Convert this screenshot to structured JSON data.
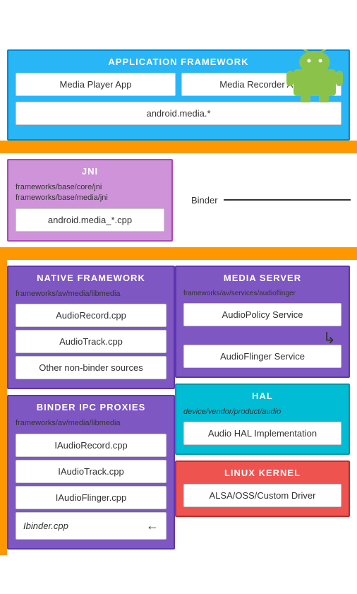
{
  "android": {
    "logo_color": "#8bc34a"
  },
  "app_framework": {
    "title": "APPLICATION FRAMEWORK",
    "media_player": "Media Player App",
    "media_recorder": "Media Recorder App",
    "android_media": "android.media.*"
  },
  "jni": {
    "title": "JNI",
    "path1": "frameworks/base/core/jni",
    "path2": "frameworks/base/media/jni",
    "cpp": "android.media_*.cpp"
  },
  "binder": {
    "label": "Binder"
  },
  "native_framework": {
    "title": "NATIVE FRAMEWORK",
    "path": "frameworks/av/media/libmedia",
    "items": [
      "AudioRecord.cpp",
      "AudioTrack.cpp",
      "Other non-binder sources"
    ]
  },
  "media_server": {
    "title": "MEDIA SERVER",
    "path": "frameworks/av/services/audioflinger",
    "items": [
      "AudioPolicy Service",
      "AudioFlinger Service"
    ]
  },
  "binder_ipc": {
    "title": "BINDER IPC PROXIES",
    "path": "frameworks/av/media/libmedia",
    "items": [
      "IAudioRecord.cpp",
      "IAudioTrack.cpp",
      "IAudioFlinger.cpp",
      "Ibinder.cpp"
    ]
  },
  "hal": {
    "title": "HAL",
    "path": "device/vendor/product/audio",
    "item": "Audio HAL Implementation"
  },
  "linux_kernel": {
    "title": "LINUX KERNEL",
    "item": "ALSA/OSS/Custom Driver"
  }
}
